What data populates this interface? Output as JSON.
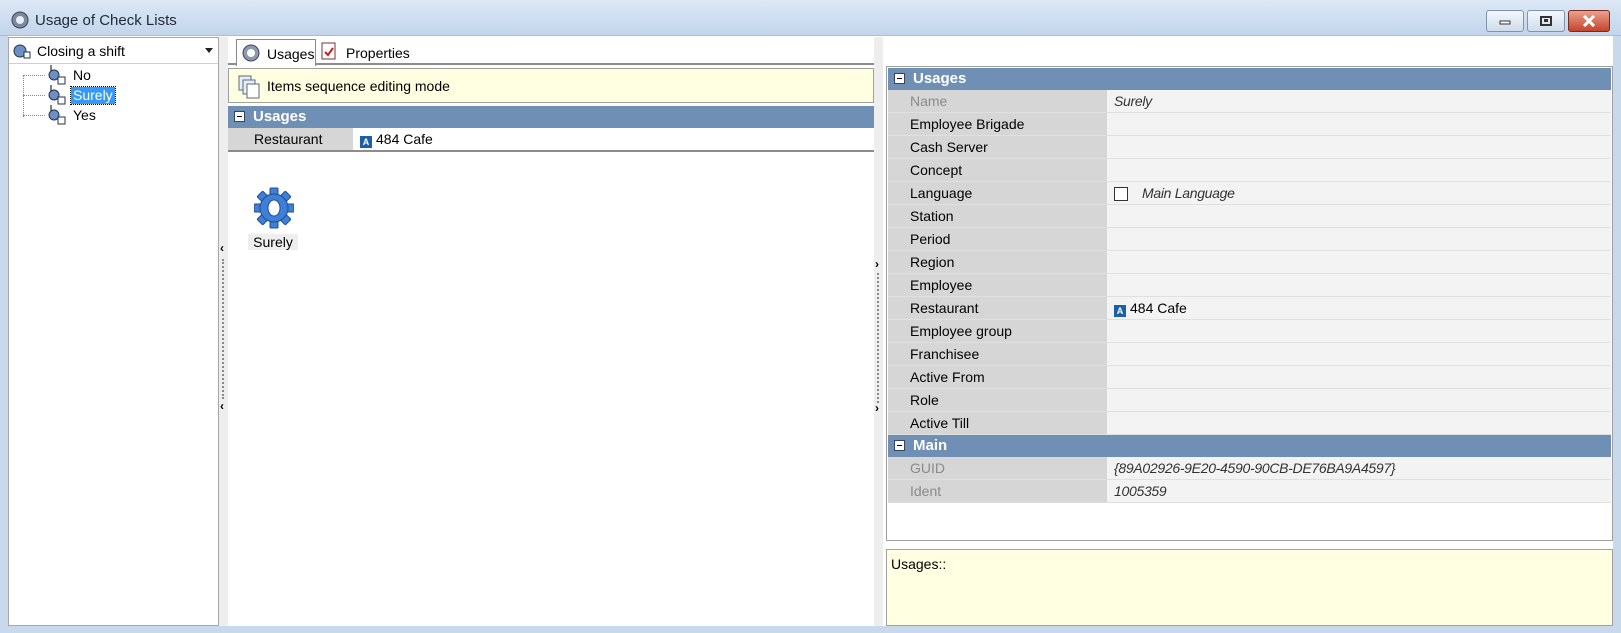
{
  "window": {
    "title": "Usage of Check Lists",
    "close_color": "#c5442c"
  },
  "left": {
    "combo_value": "Closing a shift",
    "tree": [
      {
        "label": "No",
        "selected": false
      },
      {
        "label": "Surely",
        "selected": true
      },
      {
        "label": "Yes",
        "selected": false
      }
    ]
  },
  "middle": {
    "tabs": [
      {
        "label": "Usages",
        "active": true
      },
      {
        "label": "Properties",
        "active": false
      }
    ],
    "mode_text": "Items sequence editing mode",
    "section_title": "Usages",
    "filter_row": {
      "key": "Restaurant",
      "value": "484 Cafe",
      "value_icon": "A"
    },
    "items": [
      {
        "label": "Surely",
        "icon": "gear-icon"
      }
    ]
  },
  "right": {
    "sections": [
      {
        "title": "Usages",
        "rows": [
          {
            "key": "Name",
            "value": "Surely",
            "readonly": true,
            "italic": true
          },
          {
            "key": "Employee Brigade",
            "value": ""
          },
          {
            "key": "Cash Server",
            "value": ""
          },
          {
            "key": "Concept",
            "value": ""
          },
          {
            "key": "Language",
            "value": "Main Language",
            "checkbox": true,
            "italic": true
          },
          {
            "key": "Station",
            "value": ""
          },
          {
            "key": "Period",
            "value": ""
          },
          {
            "key": "Region",
            "value": ""
          },
          {
            "key": "Employee",
            "value": ""
          },
          {
            "key": "Restaurant",
            "value": "484 Cafe",
            "value_icon": "A"
          },
          {
            "key": "Employee group",
            "value": ""
          },
          {
            "key": "Franchisee",
            "value": ""
          },
          {
            "key": "Active From",
            "value": ""
          },
          {
            "key": "Role",
            "value": ""
          },
          {
            "key": "Active Till",
            "value": ""
          }
        ]
      },
      {
        "title": "Main",
        "rows": [
          {
            "key": "GUID",
            "value": "{89A02926-9E20-4590-90CB-DE76BA9A4597}",
            "readonly": true,
            "italic": true
          },
          {
            "key": "Ident",
            "value": "1005359",
            "readonly": true,
            "italic": true
          }
        ]
      }
    ],
    "description": "Usages::"
  },
  "colors": {
    "section_header": "#6f8fb5",
    "selection": "#3399ff",
    "info_background": "#ffffe1"
  }
}
